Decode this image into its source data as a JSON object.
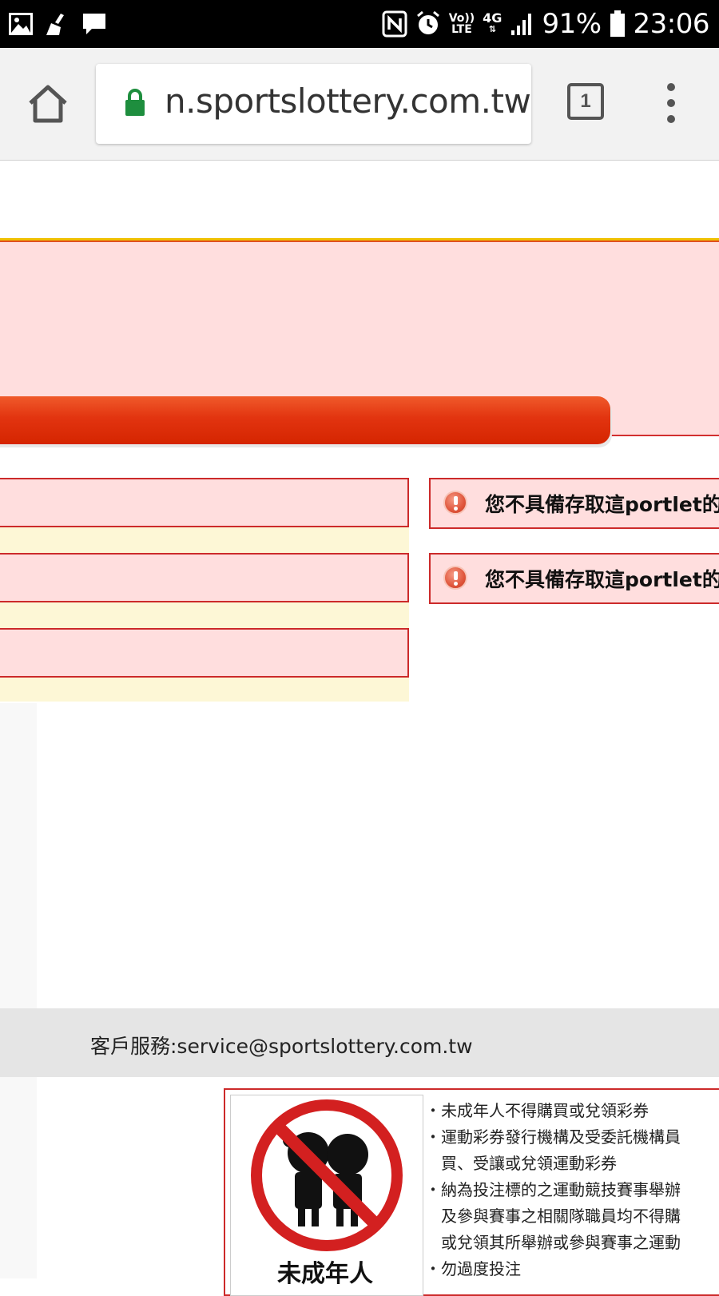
{
  "status_bar": {
    "battery": "91%",
    "time": "23:06",
    "network_type": "4G",
    "volte_top": "Vo))",
    "volte_bottom": "LTE",
    "icons": [
      "gallery-icon",
      "cleaner-icon",
      "message-icon",
      "nfc-icon",
      "alarm-icon",
      "volte-icon",
      "network-4g-icon",
      "signal-icon",
      "battery-icon"
    ]
  },
  "browser": {
    "url": "n.sportslottery.com.tw",
    "tab_count": "1",
    "icons": [
      "home-icon",
      "lock-icon",
      "tabs-icon",
      "overflow-menu-icon"
    ]
  },
  "page": {
    "error_messages": [
      "您不具備存取這portlet的",
      "您不具備存取這portlet的"
    ],
    "footer_service": "客戶服務:service@sportslottery.com.tw",
    "warning_caption": "未成年人",
    "warning_lines": [
      "・未成年人不得購買或兌領彩券",
      "・運動彩券發行機構及受委託機構員",
      "　買、受讓或兌領運動彩券",
      "・納為投注標的之運動競技賽事舉辦",
      "　及參與賽事之相關隊職員均不得購",
      "　或兌領其所舉辦或參與賽事之運動",
      "・勿過度投注"
    ]
  },
  "colors": {
    "accent_red": "#d52500",
    "panel_pink": "#ffdede",
    "panel_yellow": "#fdf7d6",
    "secure_green": "#1e8e3e"
  }
}
